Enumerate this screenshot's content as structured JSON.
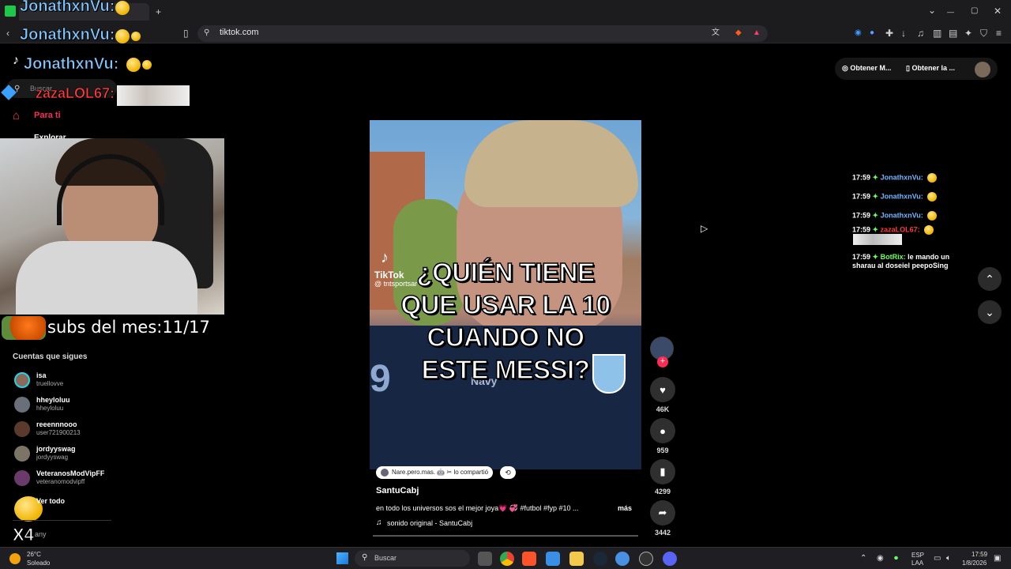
{
  "browser": {
    "url": "tiktok.com",
    "tab_new": "+",
    "window_controls": [
      "⌄",
      "—",
      "▢",
      "✕"
    ]
  },
  "overlay": {
    "chat_names": [
      "JonathxnVu:",
      "JonathxnVu:",
      "JonathxnVu:"
    ],
    "zaza_name": "zazaLOL67",
    "subs_label": "subs del mes:11/17",
    "x4": "X4"
  },
  "tiktok": {
    "search_placeholder": "Buscar",
    "nav_foryou": "Para ti",
    "nav_explore": "Explorar",
    "following_title": "Cuentas que sigues",
    "following": [
      {
        "name": "isa",
        "handle": "truellovve",
        "color": "#8a6a5a"
      },
      {
        "name": "hheyloluu",
        "handle": "hheyloluu",
        "color": "#6b6f7a"
      },
      {
        "name": "reeennnooo",
        "handle": "user721900213",
        "color": "#5a3a2c"
      },
      {
        "name": "jordyyswag",
        "handle": "jordyyswag",
        "color": "#7c7466"
      },
      {
        "name": "VeteranosModVipFF",
        "handle": "veteranomodvipff",
        "color": "#6a3a6a"
      }
    ],
    "see_all": "Ver todo",
    "bottom_partial": "any",
    "top_buttons": [
      "Obtener M...",
      "Obtener la ..."
    ]
  },
  "video": {
    "caption_lines": [
      "¿QUIÉN TIENE",
      "QUE USAR LA 10",
      "CUANDO NO",
      "ESTE MESSI?"
    ],
    "watermark_brand": "TikTok",
    "watermark_handle": "@ tntsportsar",
    "jersey_text": "Navy",
    "shared_by": "Nare.pero.mas. 🤖 ✂ lo compartió",
    "author": "SantuCabj",
    "description": "en todo los universos sos el mejor joya💗 💞 #futbol #fyp #10 ...",
    "more": "más",
    "sound": "sonido original - SantuCabj",
    "likes": "46K",
    "comments": "959",
    "saves": "4299",
    "shares": "3442"
  },
  "chat": [
    {
      "time": "17:59",
      "name": "JonathxnVu:",
      "msg": "",
      "name_color": "blue"
    },
    {
      "time": "17:59",
      "name": "JonathxnVu:",
      "msg": "",
      "name_color": "blue"
    },
    {
      "time": "17:59",
      "name": "JonathxnVu:",
      "msg": "",
      "name_color": "blue"
    },
    {
      "time": "17:59",
      "name": "zazaLOL67:",
      "msg": "",
      "name_color": "red"
    },
    {
      "time": "17:59",
      "name": "BotRix:",
      "msg": "le mando un",
      "msg2": "sharau al doseiel peepoSing",
      "name_color": "green"
    }
  ],
  "taskbar": {
    "temp": "26°C",
    "weather": "Soleado",
    "search": "Buscar",
    "lang1": "ESP",
    "lang2": "LAA",
    "time": "17:59",
    "date": "1/8/2026"
  },
  "colors": {
    "tiktok_red": "#fe2c55",
    "chat_blue": "#6fb6ff",
    "chat_red": "#ff3b3b",
    "chat_green": "#6dff5a"
  }
}
